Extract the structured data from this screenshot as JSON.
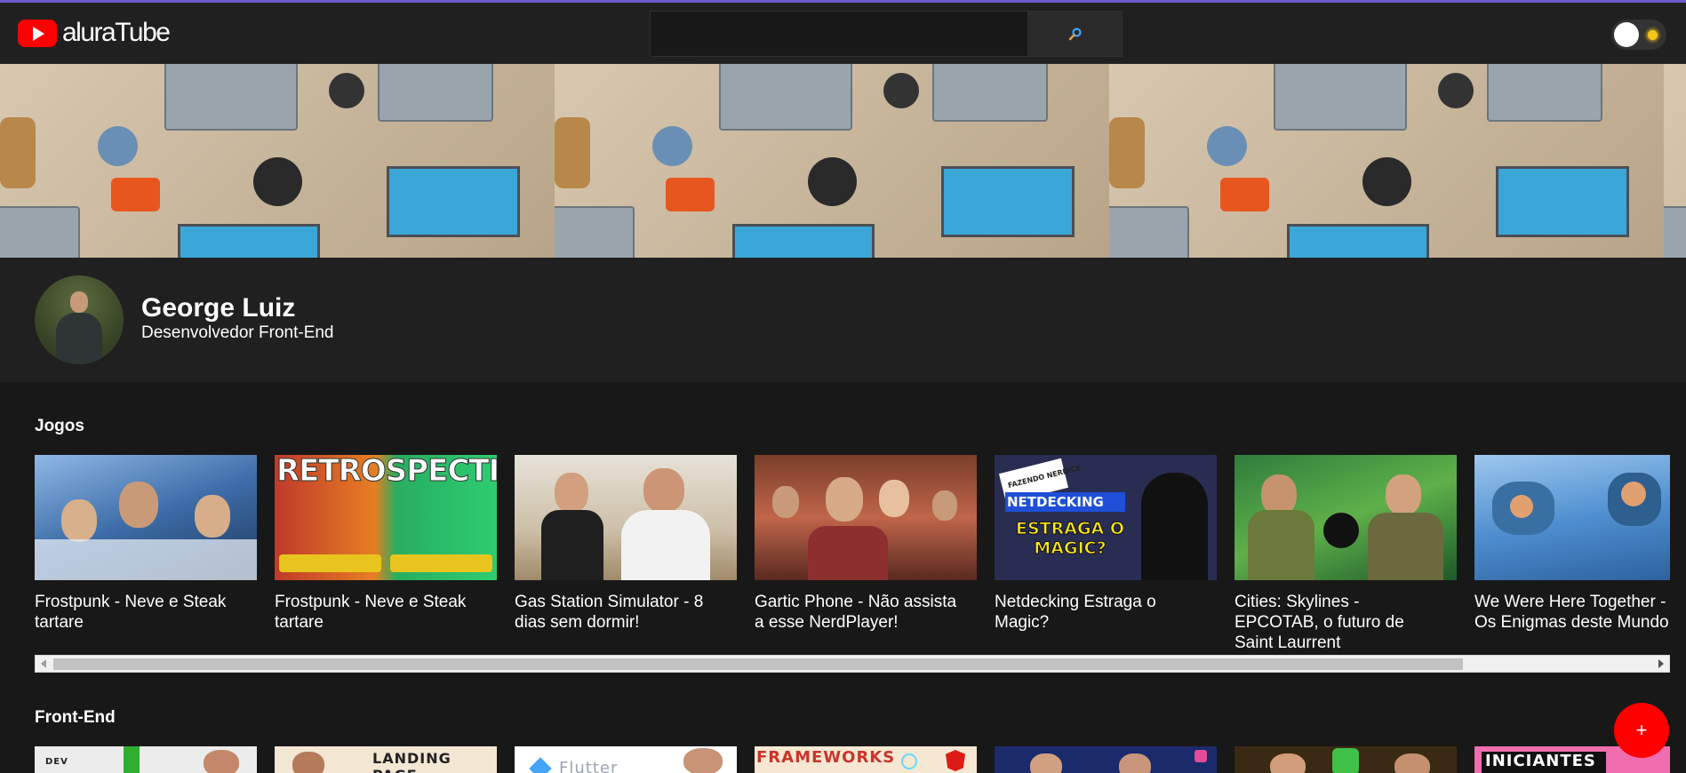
{
  "app": {
    "logo_text": "aluraTube",
    "logo_icon": "youtube-play-icon"
  },
  "search": {
    "placeholder": "",
    "value": "",
    "button_icon": "magnifier-icon"
  },
  "theme_toggle": {
    "state": "dark",
    "icon": "sun-icon"
  },
  "profile": {
    "name": "George Luiz",
    "role": "Desenvolvedor Front-End"
  },
  "sections": [
    {
      "title": "Jogos",
      "videos": [
        {
          "title": "Frostpunk - Neve e Steak tartare"
        },
        {
          "title": "Frostpunk - Neve e Steak tartare",
          "thumb_text": "RETROSPECTIVA"
        },
        {
          "title": "Gas Station Simulator - 8 dias sem dormir!"
        },
        {
          "title": "Gartic Phone - Não assista a esse NerdPlayer!"
        },
        {
          "title": "Netdecking Estraga o Magic?",
          "thumb_text": "NETDECKING",
          "thumb_text2": "ESTRAGA O MAGIC?",
          "thumb_text3": "FAZENDO NERDICE"
        },
        {
          "title": "Cities: Skylines - EPCOTAB, o futuro de Saint Laurrent"
        },
        {
          "title": "We Were Here Together - Os Enigmas deste Mundo"
        }
      ]
    },
    {
      "title": "Front-End",
      "videos": [
        {
          "thumb_text": "DEV"
        },
        {
          "thumb_text": "LANDING PAGE"
        },
        {
          "thumb_text": "Flutter"
        },
        {
          "thumb_text": "FRAMEWORKS"
        },
        {
          "thumb_text": ""
        },
        {
          "thumb_text": ""
        },
        {
          "thumb_text": "INICIANTES"
        }
      ]
    }
  ],
  "fab": {
    "label": "+"
  },
  "colors": {
    "accent": "#ff0000",
    "background": "#181818",
    "header": "#202020"
  }
}
